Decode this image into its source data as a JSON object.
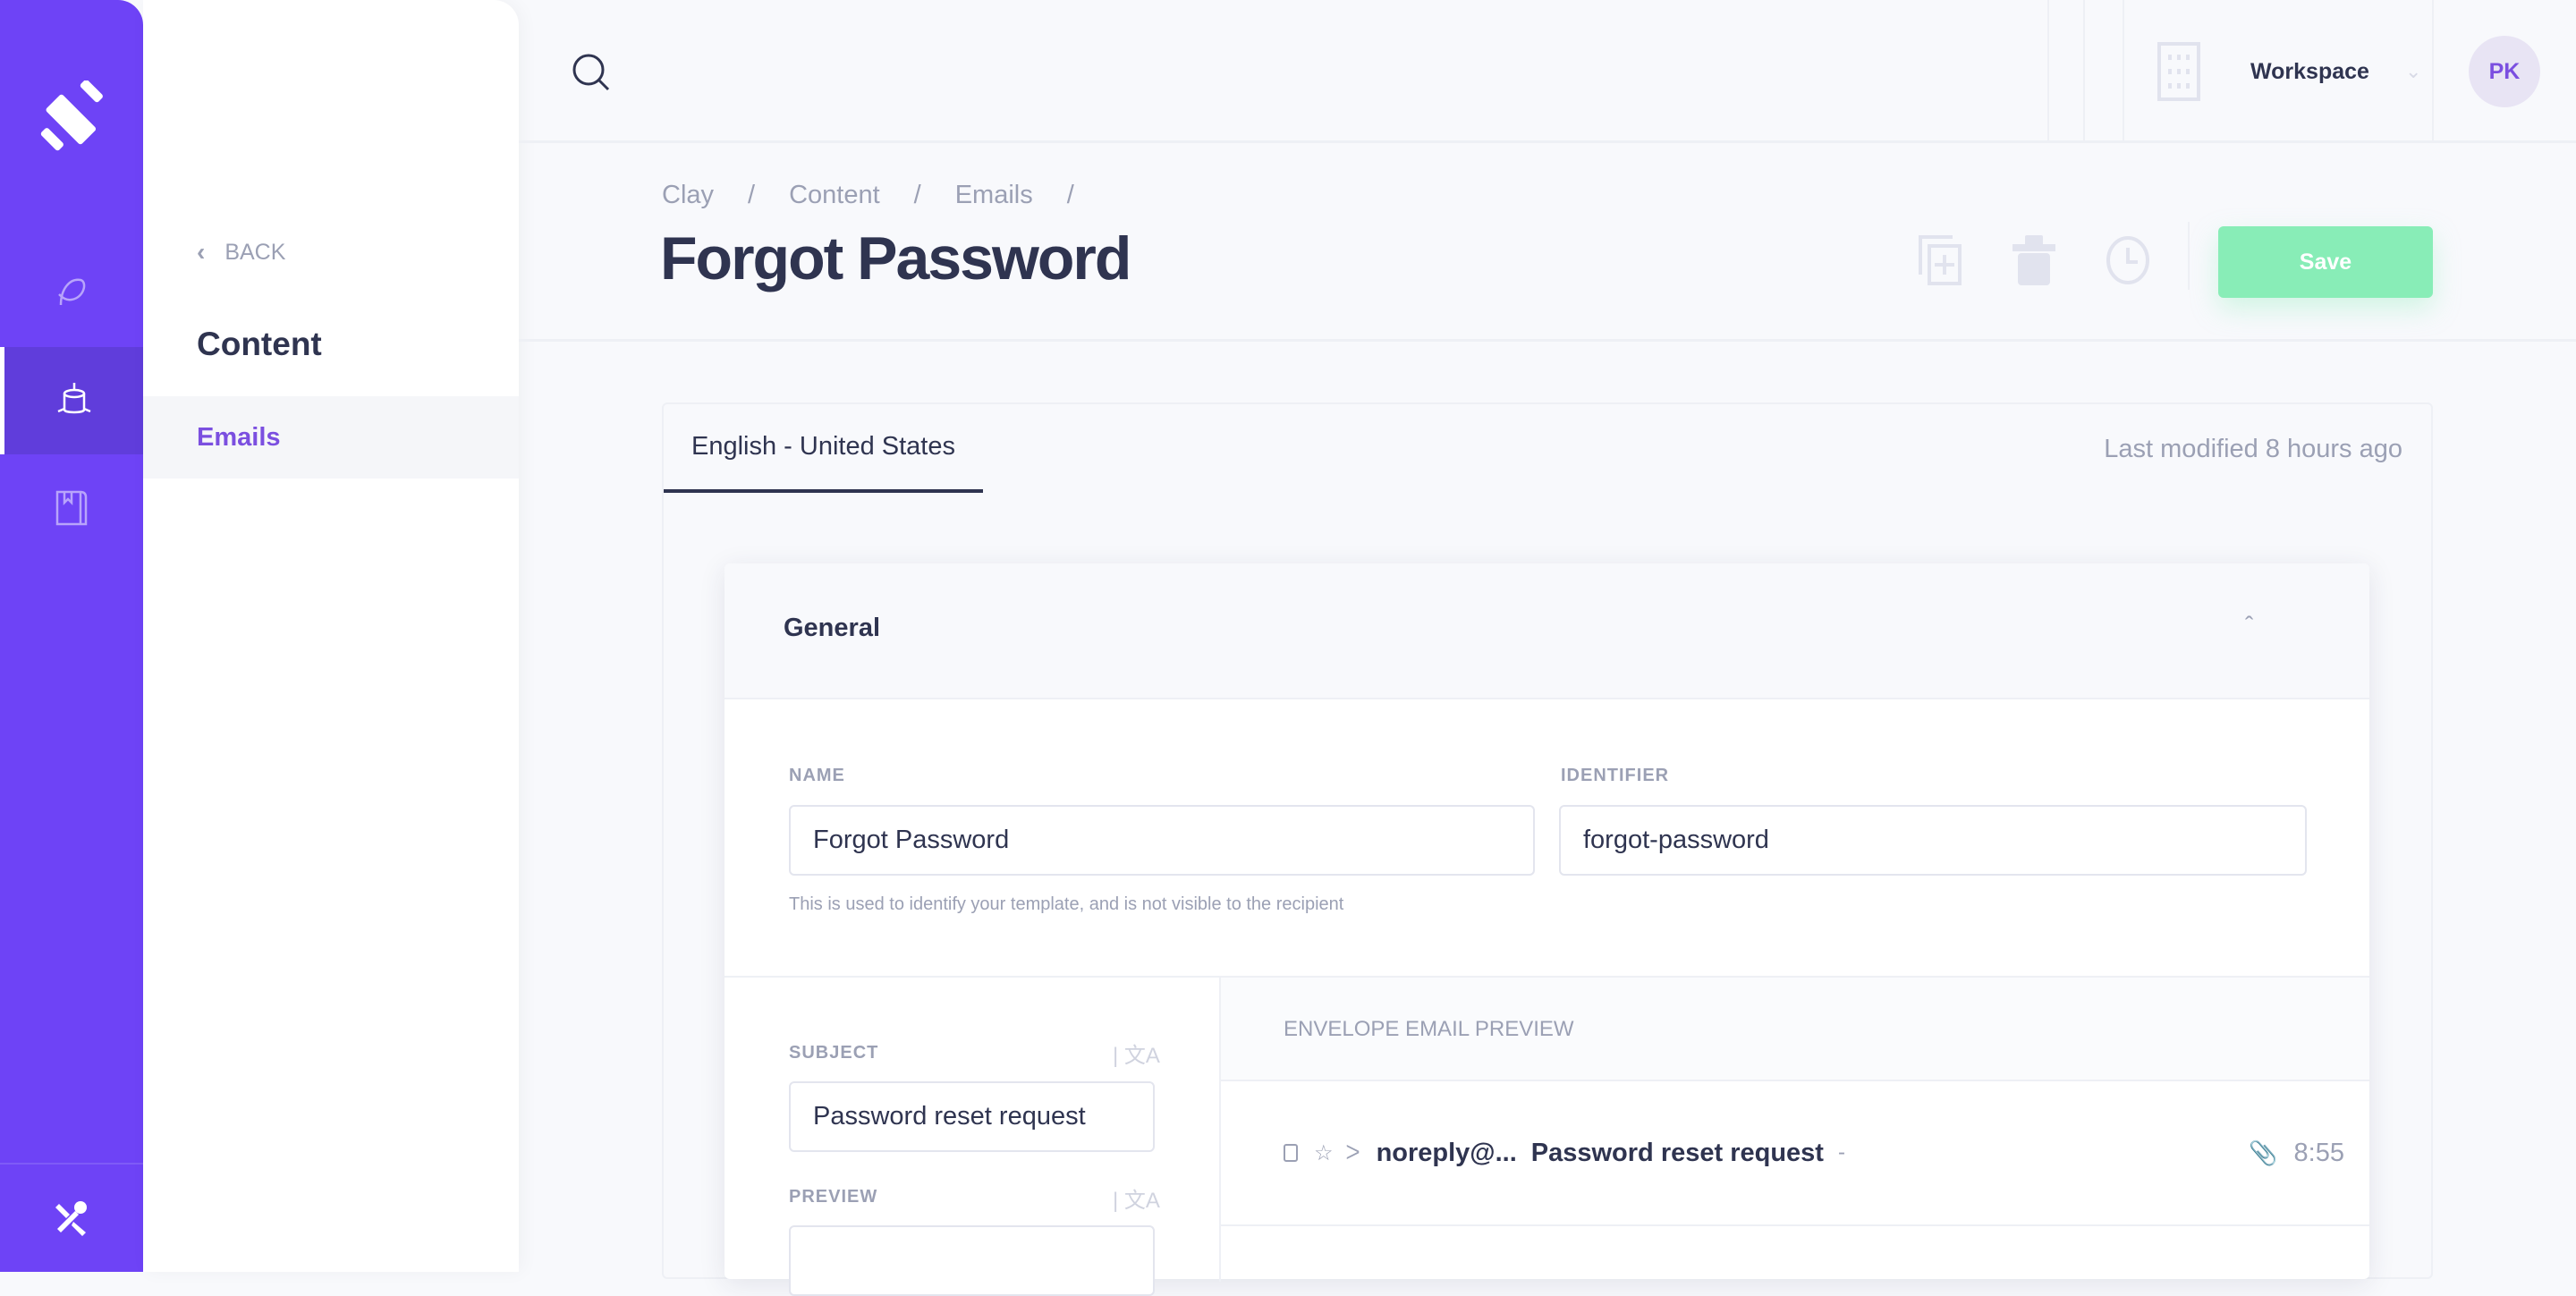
{
  "colors": {
    "rail": "#6e43f6",
    "save": "#88edb7",
    "accent": "#7b4fe0"
  },
  "rail": {
    "items": [
      {
        "icon": "leaf-icon"
      },
      {
        "icon": "database-icon",
        "active": true
      },
      {
        "icon": "book-icon"
      }
    ],
    "bottom_icon": "tools-icon"
  },
  "panel": {
    "back": "BACK",
    "title": "Content",
    "items": [
      {
        "label": "Emails",
        "active": true
      }
    ]
  },
  "topbar": {
    "workspace": "Workspace",
    "avatar": "PK"
  },
  "breadcrumb": [
    "Clay",
    "Content",
    "Emails"
  ],
  "page_title": "Forgot Password",
  "actions": {
    "save": "Save"
  },
  "tabs": [
    {
      "label": "English - United States",
      "active": true
    }
  ],
  "last_modified": "Last modified 8 hours ago",
  "general": {
    "title": "General",
    "name_label": "NAME",
    "name_value": "Forgot Password",
    "name_help": "This is used to identify your template, and is not visible to the recipient",
    "identifier_label": "IDENTIFIER",
    "identifier_value": "forgot-password",
    "subject_label": "SUBJECT",
    "subject_value": "Password reset request",
    "preview_label": "PREVIEW",
    "preview_value": "",
    "envelope_title": "ENVELOPE EMAIL PREVIEW",
    "envelope": {
      "sender": "noreply@...",
      "subject": "Password reset request",
      "separator": "-",
      "time": "8:55"
    }
  }
}
